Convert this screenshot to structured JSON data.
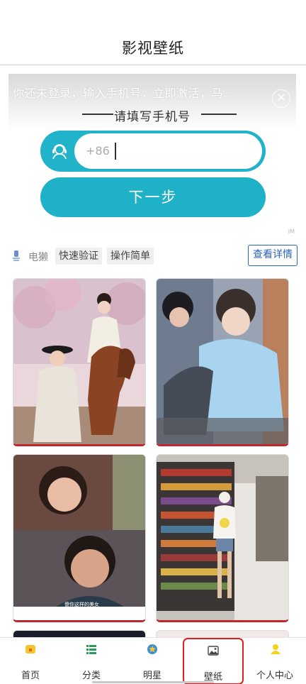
{
  "header": {
    "title": "影视壁纸"
  },
  "ad": {
    "notice": "你还未登录，输入手机号，立即激活，马…",
    "phone_title": "请填写手机号",
    "phone_prefix": "+86",
    "next_button": "下一步",
    "close_icon": "close-icon",
    "ad_mark": "IM"
  },
  "info": {
    "brand": "电獭",
    "tags": [
      "快速验证",
      "操作简单"
    ],
    "detail_button": "查看详情"
  },
  "wallpapers": [
    {
      "kind": "horse-scene",
      "caption": ""
    },
    {
      "kind": "couple-scene",
      "caption": ""
    },
    {
      "kind": "drama-stills",
      "caption": "傻你这样的美女"
    },
    {
      "kind": "supermarket",
      "caption": ""
    }
  ],
  "colors": {
    "accent": "#1fb1c8",
    "tile_border": "#c0262e",
    "tab_highlight": "#e01f1f",
    "link_blue": "#2a63b8"
  },
  "tabbar": {
    "items": [
      {
        "label": "首页",
        "icon": "home-icon"
      },
      {
        "label": "分类",
        "icon": "list-icon"
      },
      {
        "label": "明星",
        "icon": "star-icon"
      },
      {
        "label": "壁纸",
        "icon": "image-icon",
        "highlighted": true
      },
      {
        "label": "个人中心",
        "icon": "user-icon"
      }
    ]
  }
}
